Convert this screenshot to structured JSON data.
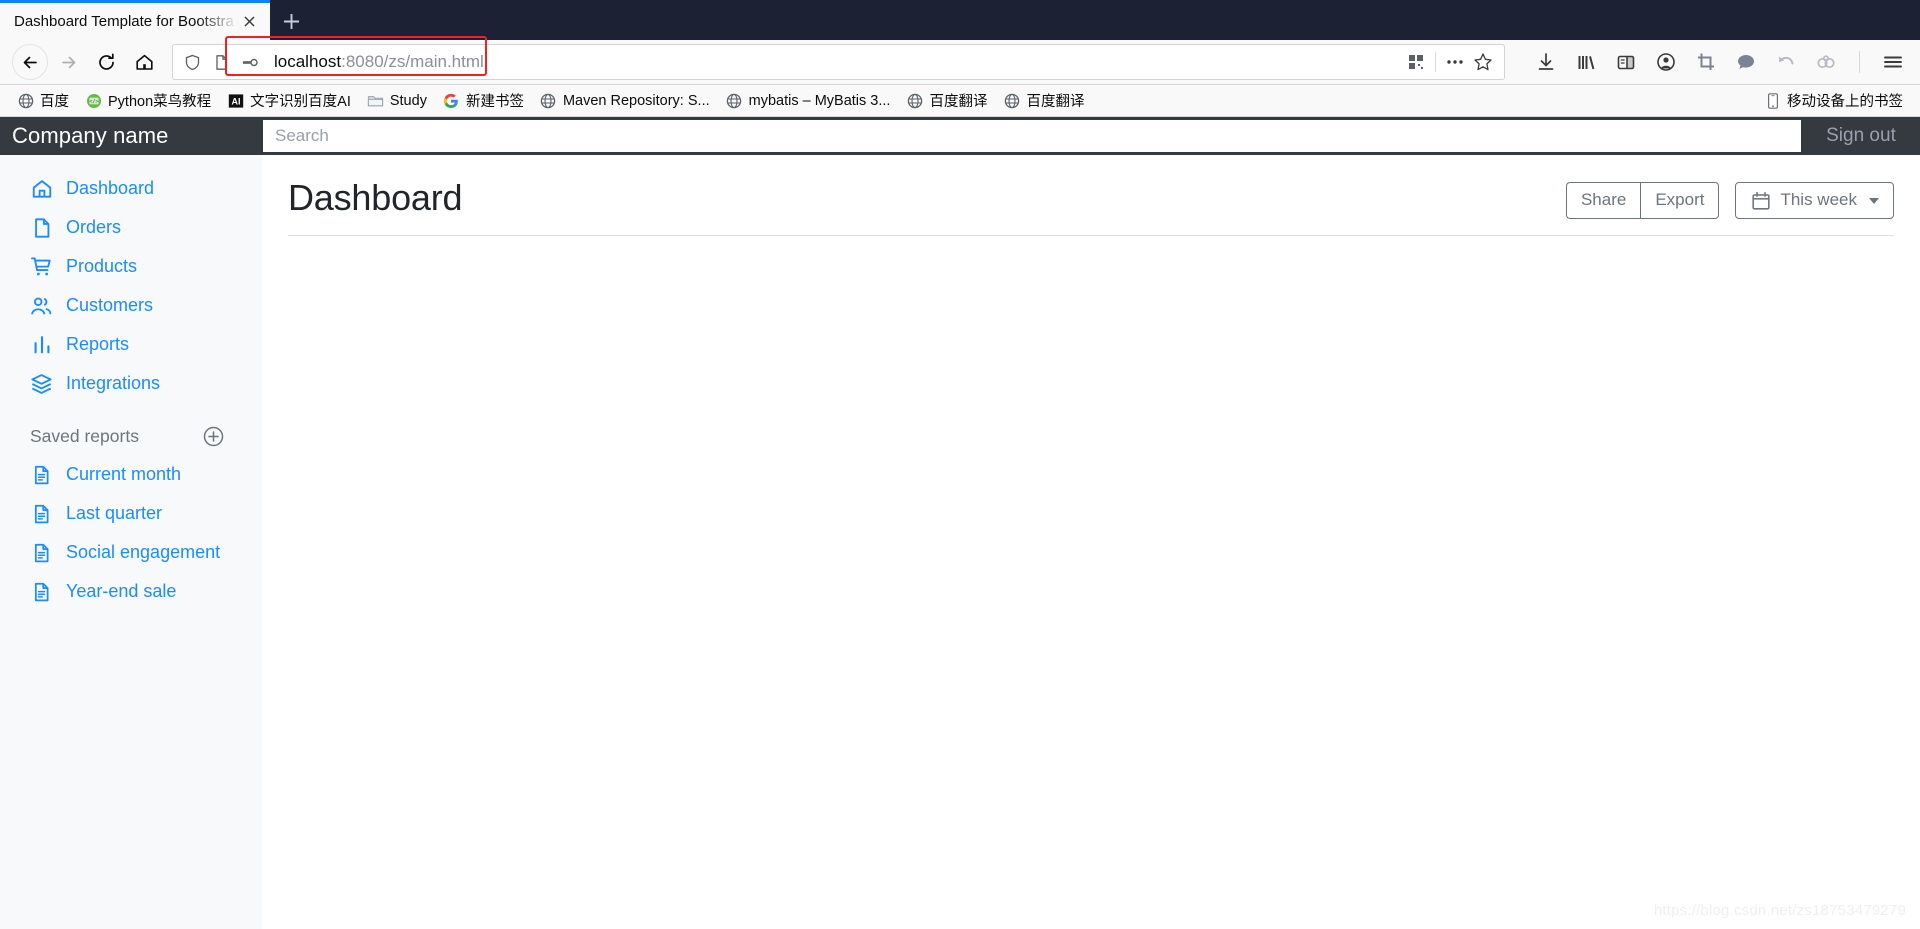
{
  "browser": {
    "tab": {
      "title": "Dashboard Template for Bootstra",
      "close_label": "✕"
    },
    "newtab_label": "+",
    "nav": {
      "back": "back-arrow",
      "forward": "forward-arrow",
      "reload": "reload",
      "home": "home"
    },
    "url": {
      "host": "localhost",
      "path": ":8080/zs/main.html",
      "full": "localhost:8080/zs/main.html"
    },
    "bookmarks": [
      {
        "label": "百度",
        "icon": "globe-icon"
      },
      {
        "label": "Python菜鸟教程",
        "icon": "code-circle-icon"
      },
      {
        "label": "文字识别百度AI",
        "icon": "ai-badge-icon"
      },
      {
        "label": "Study",
        "icon": "folder-icon"
      },
      {
        "label": "新建书签",
        "icon": "google-icon"
      },
      {
        "label": "Maven Repository: S...",
        "icon": "globe-icon"
      },
      {
        "label": "mybatis – MyBatis 3...",
        "icon": "globe-icon"
      },
      {
        "label": "百度翻译",
        "icon": "globe-icon"
      },
      {
        "label": "百度翻译",
        "icon": "globe-icon"
      }
    ],
    "mobile_bookmarks": {
      "label": "移动设备上的书签",
      "icon": "mobile-icon"
    }
  },
  "topbar": {
    "brand": "Company name",
    "search_placeholder": "Search",
    "search_value": "",
    "sign_out": "Sign out"
  },
  "sidebar": {
    "items": [
      {
        "label": "Dashboard",
        "icon": "home-icon"
      },
      {
        "label": "Orders",
        "icon": "file-icon"
      },
      {
        "label": "Products",
        "icon": "shopping-cart-icon"
      },
      {
        "label": "Customers",
        "icon": "users-icon"
      },
      {
        "label": "Reports",
        "icon": "bar-chart-icon"
      },
      {
        "label": "Integrations",
        "icon": "layers-icon"
      }
    ],
    "saved_reports": {
      "heading": "Saved reports",
      "add_label": "+",
      "items": [
        {
          "label": "Current month",
          "icon": "file-text-icon"
        },
        {
          "label": "Last quarter",
          "icon": "file-text-icon"
        },
        {
          "label": "Social engagement",
          "icon": "file-text-icon"
        },
        {
          "label": "Year-end sale",
          "icon": "file-text-icon"
        }
      ]
    }
  },
  "main": {
    "title": "Dashboard",
    "share_label": "Share",
    "export_label": "Export",
    "range_label": "This week"
  },
  "watermark": "https://blog.csdn.net/zs18753479279",
  "colors": {
    "accent": "#1a8cff",
    "topbar_bg": "#343a40",
    "sidebar_bg": "#f8f9fa",
    "annotation": "#ee2222",
    "muted": "#6c757d"
  }
}
